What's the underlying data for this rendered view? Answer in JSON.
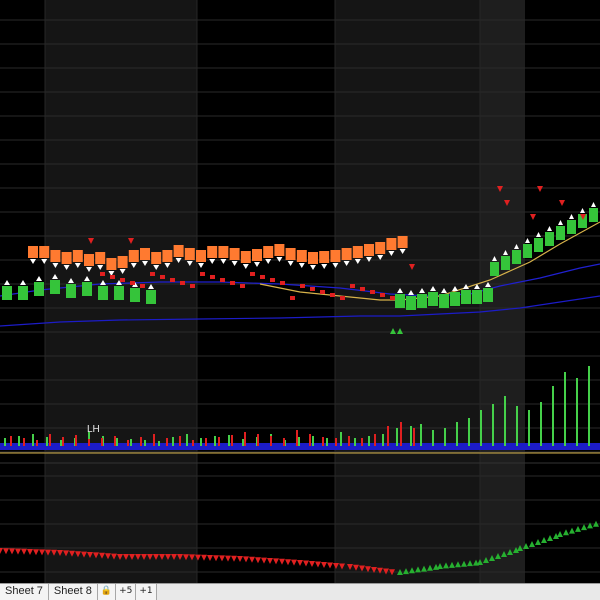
{
  "chart_data": [
    {
      "type": "candlestick",
      "panel": "price",
      "title": "",
      "xlabel": "",
      "ylabel": "",
      "bar_groups": [
        {
          "name": "upper-orange-bands",
          "color": "#ff7a30",
          "values": [
            246,
            246,
            250,
            252,
            250,
            254,
            252,
            258,
            256,
            250,
            248,
            252,
            250,
            245,
            248,
            250,
            246,
            246,
            248,
            251,
            249,
            246,
            244,
            248,
            250,
            252,
            251,
            250,
            248,
            246,
            244,
            242,
            238,
            236
          ]
        },
        {
          "name": "lower-green-bands",
          "color": "#35c43a",
          "values": [
            292,
            292,
            288,
            286,
            290,
            288,
            292,
            292,
            294,
            296,
            300,
            302,
            300,
            298,
            300,
            298,
            296,
            296,
            294
          ]
        }
      ],
      "moving_averages": [
        {
          "color": "#1c1cc8",
          "points": [
            [
              0,
              326
            ],
            [
              60,
              322
            ],
            [
              120,
              320
            ],
            [
              200,
              319
            ],
            [
              280,
              318
            ],
            [
              360,
              316
            ],
            [
              400,
              316
            ],
            [
              440,
              314
            ],
            [
              480,
              312
            ],
            [
              520,
              308
            ],
            [
              560,
              302
            ],
            [
              600,
              296
            ]
          ]
        },
        {
          "color": "#2020d0",
          "points": [
            [
              0,
              296
            ],
            [
              40,
              290
            ],
            [
              100,
              284
            ],
            [
              160,
              282
            ],
            [
              220,
              282
            ],
            [
              280,
              284
            ],
            [
              340,
              288
            ],
            [
              390,
              294
            ],
            [
              430,
              296
            ],
            [
              470,
              294
            ],
            [
              500,
              286
            ],
            [
              540,
              278
            ],
            [
              580,
              268
            ],
            [
              600,
              264
            ]
          ]
        },
        {
          "color": "#d7b24a",
          "points": [
            [
              260,
              284
            ],
            [
              300,
              292
            ],
            [
              340,
              296
            ],
            [
              380,
              300
            ],
            [
              400,
              300
            ],
            [
              440,
              296
            ],
            [
              490,
              280
            ],
            [
              530,
              262
            ],
            [
              560,
              244
            ],
            [
              600,
              222
            ]
          ]
        }
      ],
      "signals": {
        "down_red_arrows_x": [
          91,
          131,
          412,
          500,
          507,
          533,
          540,
          562,
          583
        ],
        "up_green_arrows_x": [
          393,
          400
        ]
      }
    },
    {
      "type": "bar",
      "panel": "volume",
      "title": "",
      "annotation": "LH",
      "series": [
        {
          "name": "",
          "color": "#45d04a",
          "values": [
            8,
            10,
            12,
            9,
            6,
            8,
            14,
            10,
            8,
            7,
            6,
            5,
            9,
            12,
            8,
            10,
            11,
            7,
            9,
            12,
            6,
            9,
            10,
            8,
            14,
            8,
            10,
            12,
            18,
            20,
            22,
            16,
            18,
            24,
            28,
            36,
            42,
            50,
            40,
            36,
            44,
            60,
            74,
            68,
            80
          ]
        },
        {
          "name": "",
          "color": "#e02020",
          "values": [
            10,
            8,
            6,
            12,
            9,
            11,
            7,
            8,
            10,
            6,
            9,
            12,
            8,
            10,
            6,
            8,
            9,
            11,
            14,
            12,
            10,
            8,
            16,
            12,
            9,
            8,
            10,
            8,
            12,
            20,
            24,
            18
          ]
        }
      ],
      "baseline_color": "#d7b24a"
    },
    {
      "type": "line",
      "panel": "oscillator",
      "title": "",
      "series": [
        {
          "name": "",
          "color": "#e02020",
          "points": [
            [
              0,
              550
            ],
            [
              60,
              552
            ],
            [
              120,
              556
            ],
            [
              180,
              556
            ],
            [
              240,
              558
            ],
            [
              300,
              562
            ],
            [
              350,
              566
            ],
            [
              400,
              572
            ]
          ]
        },
        {
          "name": "",
          "color": "#26b030",
          "points": [
            [
              400,
              572
            ],
            [
              440,
              566
            ],
            [
              480,
              562
            ],
            [
              520,
              548
            ],
            [
              560,
              534
            ],
            [
              600,
              522
            ]
          ]
        }
      ]
    }
  ],
  "annotations": {
    "lh": "LH"
  },
  "tabs": [
    {
      "label": "Sheet 7"
    },
    {
      "label": "Sheet 8"
    }
  ],
  "tab_tools": [
    {
      "icon": "lock-icon",
      "glyph": "🔒"
    },
    {
      "icon": "add-sheet-icon",
      "glyph": "+5"
    },
    {
      "icon": "sheet-nav-icon",
      "glyph": "+1"
    }
  ],
  "colors": {
    "background": "#000000",
    "panel_alt": "#141414",
    "grid": "#2a2a2a",
    "orange": "#ff7a30",
    "green": "#35c43a",
    "red": "#e02020",
    "blue": "#1c1cc8",
    "white_arrow": "#ffffff"
  }
}
